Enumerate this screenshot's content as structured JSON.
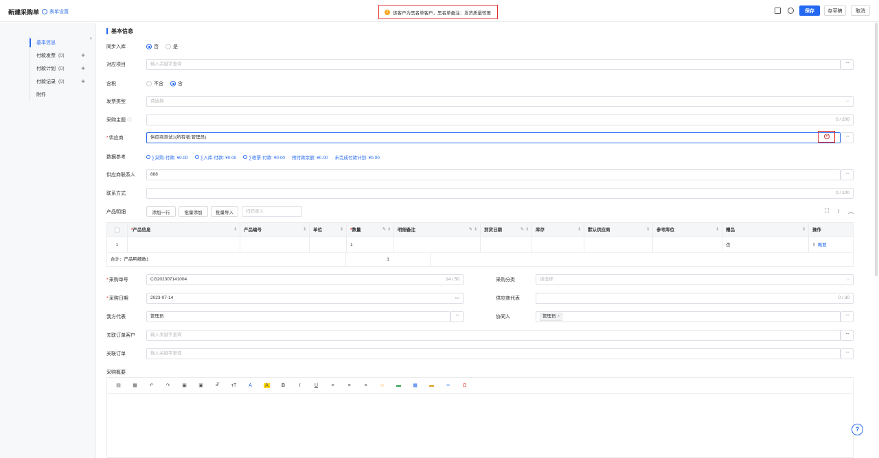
{
  "header": {
    "title": "新建采购单",
    "form_settings": "表单设置",
    "alert": "该客户为黑名单客户，黑名单备注：发货质量较差",
    "save": "保存",
    "draft": "存草稿",
    "cancel": "取消"
  },
  "sidebar": {
    "items": [
      {
        "label": "基本信息",
        "count": "",
        "active": true
      },
      {
        "label": "付款发票",
        "count": "(0)"
      },
      {
        "label": "付款计划",
        "count": "(0)"
      },
      {
        "label": "付款记录",
        "count": "(0)"
      },
      {
        "label": "附件",
        "count": ""
      }
    ]
  },
  "section_title": "基本信息",
  "form": {
    "sync_stock": {
      "label": "同步入库",
      "options": [
        "否",
        "是"
      ],
      "selected": "否"
    },
    "project": {
      "label": "对应项目",
      "placeholder": "输入关键字查询"
    },
    "tax": {
      "label": "含税",
      "options": [
        "不含",
        "含"
      ],
      "selected": "含"
    },
    "invoice_type": {
      "label": "发票类型",
      "placeholder": "请选择"
    },
    "subject": {
      "label": "采购主题",
      "counter": "0 / 200"
    },
    "supplier": {
      "label": "供应商",
      "value": "供应商测试1(所有者:管理员)"
    },
    "data_ref": {
      "label": "数据参考",
      "items": [
        "∑采购-付款: ¥0.00",
        "∑入库-付款: ¥0.00",
        "∑收票-付款: ¥0.00"
      ],
      "plain": [
        "预付款余额: ¥0.00",
        "未完成付款计划: ¥0.00"
      ]
    },
    "supplier_contact": {
      "label": "供应商联系人",
      "value": "888"
    },
    "contact": {
      "label": "联系方式",
      "counter": "0 / 100"
    },
    "product_detail": {
      "label": "产品明细",
      "add_row": "添加一行",
      "batch_add": "批量添加",
      "batch_import": "批量导入",
      "scan_placeholder": "扫码录入"
    },
    "order_no": {
      "label": "采购单号",
      "value": "CG202307141004",
      "counter": "14 / 50"
    },
    "category": {
      "label": "采购分类",
      "placeholder": "请选择"
    },
    "order_date": {
      "label": "采购日期",
      "value": "2023-07-14"
    },
    "supplier_rep": {
      "label": "供应商代表",
      "counter": "0 / 30"
    },
    "our_rep": {
      "label": "我方代表",
      "value": "管理员"
    },
    "collaborator": {
      "label": "协同人",
      "tag": "管理员"
    },
    "linked_customer": {
      "label": "关联订单客户",
      "placeholder": "输入关键字查询"
    },
    "linked_order": {
      "label": "关联订单",
      "placeholder": "输入关键字查询"
    },
    "summary": {
      "label": "采购概要"
    }
  },
  "table": {
    "headers": [
      "产品信息",
      "产品编号",
      "单位",
      "数量",
      "明细备注",
      "到货日期",
      "库存",
      "默认供应商",
      "参考库位",
      "赠品",
      "操作"
    ],
    "row": {
      "index": "1",
      "qty": "1",
      "gift": "否",
      "action": "概要"
    },
    "summary": {
      "label": "合计：产品明细数1",
      "qty": "1"
    }
  }
}
